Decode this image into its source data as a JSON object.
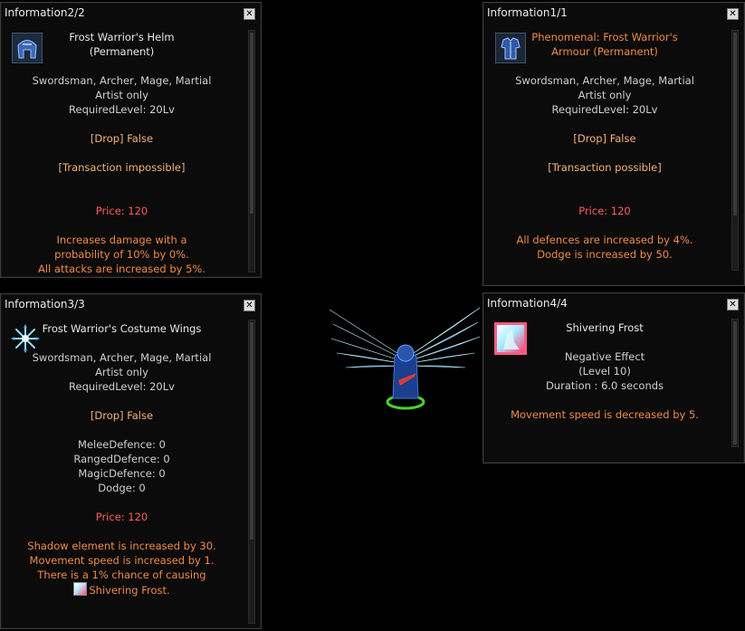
{
  "panels": {
    "helm": {
      "title": "Information2/2",
      "close": "✕",
      "item_name_1": "Frost Warrior's Helm",
      "item_name_2": "(Permanent)",
      "classes_1": "Swordsman, Archer, Mage, Martial",
      "classes_2": "Artist only",
      "required_level": "RequiredLevel: 20Lv",
      "drop": "[Drop] False",
      "transaction": "[Transaction impossible]",
      "price": "Price: 120",
      "effect_1": "Increases damage with a",
      "effect_2": "probability of 10% by 0%.",
      "effect_3": "All attacks are increased by 5%."
    },
    "armour": {
      "title": "Information1/1",
      "close": "✕",
      "item_name_1": "Phenomenal: Frost Warrior's",
      "item_name_2": "Armour (Permanent)",
      "classes_1": "Swordsman, Archer, Mage, Martial",
      "classes_2": "Artist only",
      "required_level": "RequiredLevel: 20Lv",
      "drop": "[Drop] False",
      "transaction": "[Transaction possible]",
      "price": "Price: 120",
      "effect_1": "All defences are increased by 4%.",
      "effect_2": "Dodge is increased by 50."
    },
    "wings": {
      "title": "Information3/3",
      "close": "✕",
      "item_name": "Frost Warrior's Costume Wings",
      "classes_1": "Swordsman, Archer, Mage, Martial",
      "classes_2": "Artist only",
      "required_level": "RequiredLevel: 20Lv",
      "drop": "[Drop] False",
      "melee": "MeleeDefence: 0",
      "ranged": "RangedDefence: 0",
      "magic": "MagicDefence: 0",
      "dodge": "Dodge: 0",
      "price": "Price: 120",
      "effect_1": "Shadow element is increased by 30.",
      "effect_2": "Movement speed is increased by 1.",
      "effect_3": "There is a 1% chance of causing",
      "effect_4": "Shivering Frost."
    },
    "frost": {
      "title": "Information4/4",
      "close": "✕",
      "name": "Shivering Frost",
      "type": "Negative Effect",
      "level": "(Level 10)",
      "duration": "Duration : 6.0 seconds",
      "effect": "Movement speed is decreased by 5."
    }
  },
  "colors": {
    "accent_orange": "#f08a46",
    "price_red": "#ff5d5d",
    "transaction_peach": "#f3b27a"
  },
  "icons": {
    "helm": "helm-icon",
    "armour": "armour-icon",
    "wings": "snowflake-icon",
    "frost": "frost-debuff-icon"
  }
}
